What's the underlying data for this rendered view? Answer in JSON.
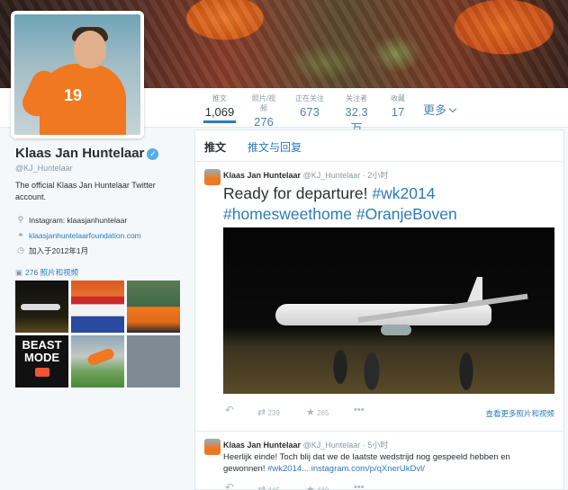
{
  "profile": {
    "name": "Klaas Jan Huntelaar",
    "handle": "@KJ_Huntelaar",
    "bio": "The official Klaas Jan Huntelaar Twitter account.",
    "instagram": "Instagram: klaasjanhuntelaar",
    "website": "klaasjanhuntelaarfoundation.com",
    "joined": "加入于2012年1月",
    "photos_label": "276 照片和视频",
    "avatar_number": "19",
    "thumb4_text": "BEAST MODE"
  },
  "stats": [
    {
      "label": "推文",
      "value": "1,069"
    },
    {
      "label": "照片/视频",
      "value": "276"
    },
    {
      "label": "正在关注",
      "value": "673"
    },
    {
      "label": "关注者",
      "value": "32.3万"
    },
    {
      "label": "收藏",
      "value": "17"
    }
  ],
  "more_label": "更多",
  "tabs": {
    "tweets": "推文",
    "replies": "推文与回复"
  },
  "tweets": [
    {
      "name": "Klaas Jan Huntelaar",
      "handle": "@KJ_Huntelaar",
      "time": "· 2小时",
      "text": "Ready for departure!",
      "tags": [
        "#wk2014",
        "#homesweethome",
        "#OranjeBoven"
      ],
      "retweets": "239",
      "favorites": "285",
      "view_more": "查看更多照片和视频"
    },
    {
      "name": "Klaas Jan Huntelaar",
      "handle": "@KJ_Huntelaar",
      "time": "· 5小时",
      "text": "Heerlijk einde! Toch blij dat we de laatste wedstrijd nog gespeeld hebben en gewonnen!",
      "tag": "#wk2014...",
      "link": "instagram.com/p/qXnerUkDvl/",
      "retweets": "445",
      "favorites": "449"
    }
  ],
  "icons": {
    "verified": "verified-badge-icon",
    "location": "location-pin-icon",
    "link": "link-icon",
    "calendar": "calendar-icon",
    "camera": "camera-icon",
    "reply": "reply-icon",
    "retweet": "retweet-icon",
    "favorite": "star-icon",
    "more": "ellipsis-icon"
  },
  "colors": {
    "accent": "#2b7bb9",
    "verified": "#55acee",
    "muted": "#8899a6"
  }
}
